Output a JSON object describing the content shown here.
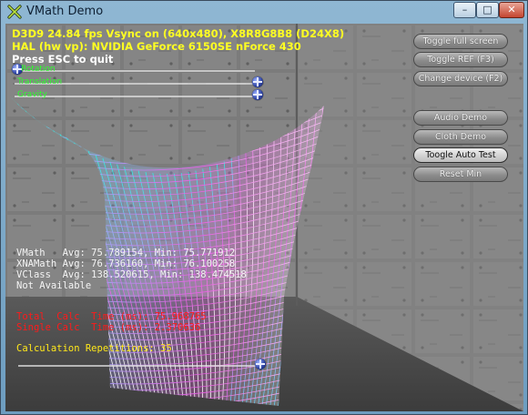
{
  "window": {
    "title": "VMath Demo",
    "icon": "directx-x-icon",
    "min": "–",
    "max": "□",
    "close": "✕"
  },
  "hud": {
    "line1": "D3D9 24.84 fps Vsync on (640x480), X8R8G8B8 (D24X8)",
    "line2": "HAL (hw vp): NVIDIA GeForce 6150SE nForce 430",
    "line3": "Press ESC to quit"
  },
  "sliders": [
    {
      "label": "Rotation",
      "value": 0.0
    },
    {
      "label": "Translation",
      "value": 1.0
    },
    {
      "label": "Gravity",
      "value": 1.0
    }
  ],
  "buttons_top": [
    "Toggle full screen",
    "Toggle REF (F3)",
    "Change device (F2)"
  ],
  "buttons_demo": [
    "Audio Demo",
    "Cloth Demo",
    "Toogle Auto Test",
    "Reset Min"
  ],
  "stats": {
    "vmath": "VMath   Avg: 75.789154, Min: 75.771912",
    "xnamath": "XNAMath Avg: 76.736160, Min: 76.100258",
    "vclass": "VClass  Avg: 138.520615, Min: 138.474518",
    "notavail": "Not Available",
    "total": "Total  Calc  Time (ms): 75.968765",
    "single": "Single Calc  Time (ms): 2.370636",
    "reps": "Calculation Repetitions: 35"
  },
  "reps_slider": {
    "value": 0.98
  },
  "colors": {
    "hud_text": "#ffff22",
    "slider_label": "#2cff2c",
    "stat_white": "#f4f4f4",
    "stat_red": "#ff1a1a",
    "stat_yellow": "#ffe81a"
  }
}
